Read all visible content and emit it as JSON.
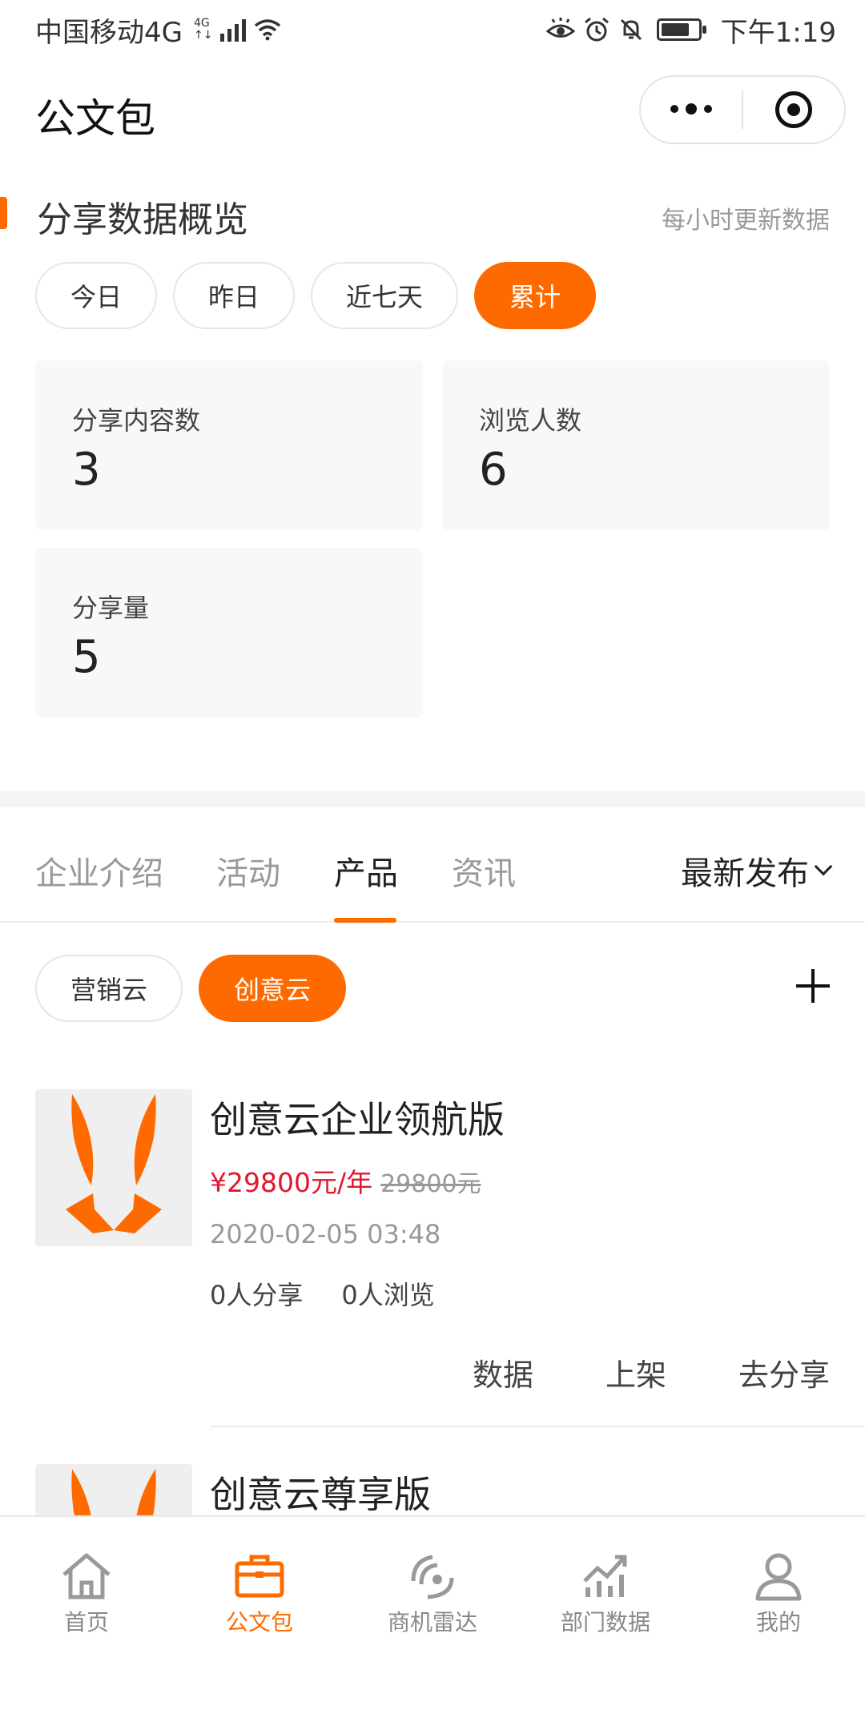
{
  "status_bar": {
    "carrier": "中国移动4G",
    "net_top": "4G",
    "net_bottom": "↑↓",
    "time": "下午1:19",
    "icons": [
      "signal-icon",
      "wifi-icon",
      "eye-icon",
      "alarm-icon",
      "mute-icon",
      "battery-icon"
    ]
  },
  "header": {
    "title": "公文包",
    "capsule_icons": [
      "more-dots-icon",
      "close-target-icon"
    ]
  },
  "overview": {
    "title": "分享数据概览",
    "note": "每小时更新数据",
    "periods": [
      "今日",
      "昨日",
      "近七天",
      "累计"
    ],
    "active_period": "累计",
    "stats": [
      {
        "label": "分享内容数",
        "value": "3"
      },
      {
        "label": "浏览人数",
        "value": "6"
      },
      {
        "label": "分享量",
        "value": "5"
      }
    ]
  },
  "tabs": {
    "items": [
      "企业介绍",
      "活动",
      "产品",
      "资讯"
    ],
    "active": "产品",
    "sort_label": "最新发布"
  },
  "sub_categories": {
    "items": [
      "营销云",
      "创意云"
    ],
    "active": "创意云"
  },
  "products": [
    {
      "name": "创意云企业领航版",
      "price": "¥29800元/年",
      "original_price": "29800元",
      "date": "2020-02-05 03:48",
      "shares": "0人分享",
      "views": "0人浏览",
      "actions": [
        "数据",
        "上架",
        "去分享"
      ]
    },
    {
      "name": "创意云尊享版"
    }
  ],
  "bottom_nav": {
    "items": [
      "首页",
      "公文包",
      "商机雷达",
      "部门数据",
      "我的"
    ],
    "active": "公文包"
  },
  "colors": {
    "accent": "#ff6a00",
    "price_red": "#e0182e"
  }
}
